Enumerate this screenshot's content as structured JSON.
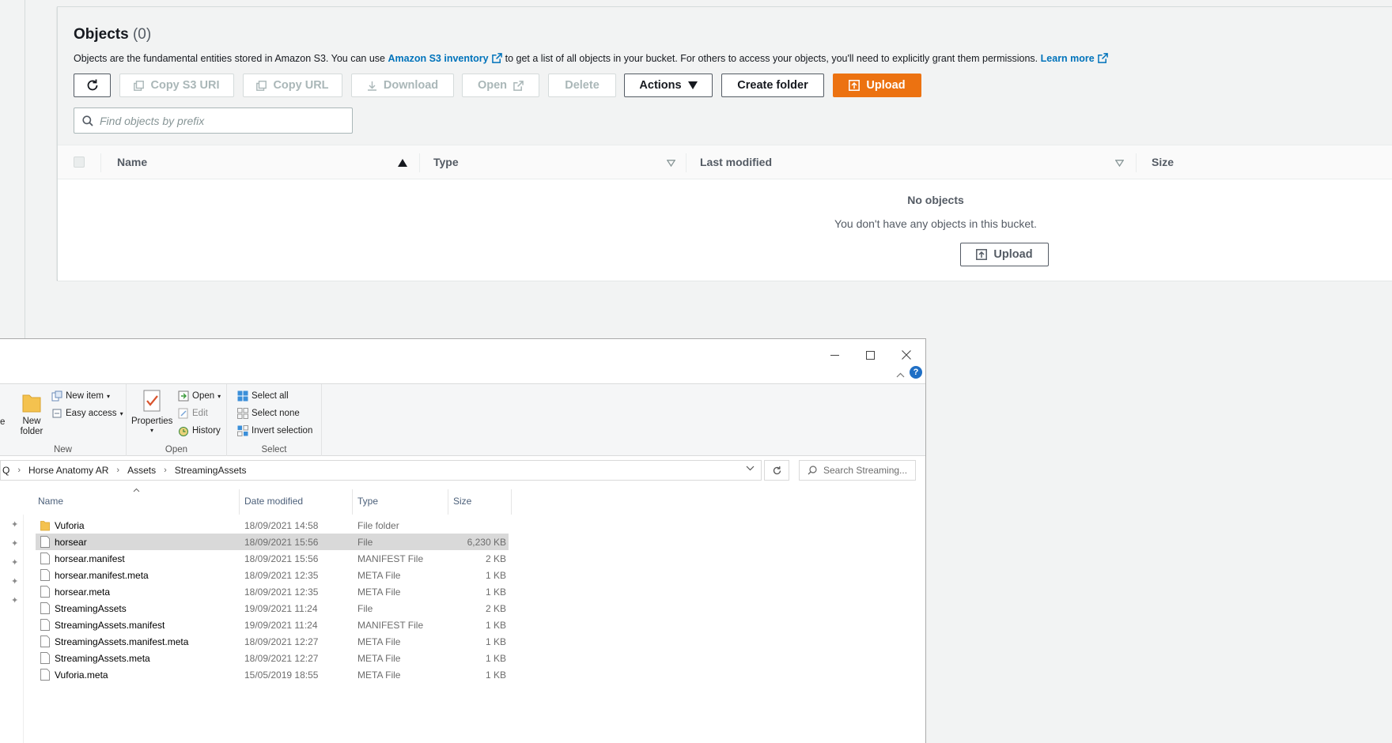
{
  "s3": {
    "objects_title": "Objects",
    "objects_count": "(0)",
    "description_pre": "Objects are the fundamental entities stored in Amazon S3. You can use",
    "inventory_link": "Amazon S3 inventory",
    "description_mid": "to get a list of all objects in your bucket. For others to access your objects, you'll need to explicitly grant them permissions.",
    "learn_more": "Learn more",
    "buttons": {
      "copy_s3_uri": "Copy S3 URI",
      "copy_url": "Copy URL",
      "download": "Download",
      "open": "Open",
      "delete": "Delete",
      "actions": "Actions",
      "create_folder": "Create folder",
      "upload": "Upload"
    },
    "search_placeholder": "Find objects by prefix",
    "columns": [
      "Name",
      "Type",
      "Last modified",
      "Size"
    ],
    "empty_title": "No objects",
    "empty_message": "You don't have any objects in this bucket.",
    "empty_upload": "Upload",
    "colors": {
      "accent": "#ec7211",
      "link": "#0073bb"
    }
  },
  "explorer": {
    "ribbon": {
      "new_item": "New item",
      "easy_access": "Easy access",
      "new_folder_line1": "New",
      "new_folder_line2": "folder",
      "group_new": "New",
      "properties": "Properties",
      "open": "Open",
      "edit": "Edit",
      "history": "History",
      "group_open": "Open",
      "select_all": "Select all",
      "select_none": "Select none",
      "invert_selection": "Invert selection",
      "group_select": "Select",
      "cut_fragment": "e"
    },
    "address": {
      "fragment": "Q",
      "crumbs": [
        "Horse Anatomy AR",
        "Assets",
        "StreamingAssets"
      ]
    },
    "search_placeholder": "Search Streaming...",
    "columns": {
      "name": "Name",
      "date": "Date modified",
      "type": "Type",
      "size": "Size"
    },
    "files": [
      {
        "name": "Vuforia",
        "date": "18/09/2021 14:58",
        "type": "File folder",
        "size": "",
        "folder": true
      },
      {
        "name": "horsear",
        "date": "18/09/2021 15:56",
        "type": "File",
        "size": "6,230 KB",
        "selected": true
      },
      {
        "name": "horsear.manifest",
        "date": "18/09/2021 15:56",
        "type": "MANIFEST File",
        "size": "2 KB"
      },
      {
        "name": "horsear.manifest.meta",
        "date": "18/09/2021 12:35",
        "type": "META File",
        "size": "1 KB"
      },
      {
        "name": "horsear.meta",
        "date": "18/09/2021 12:35",
        "type": "META File",
        "size": "1 KB"
      },
      {
        "name": "StreamingAssets",
        "date": "19/09/2021 11:24",
        "type": "File",
        "size": "2 KB"
      },
      {
        "name": "StreamingAssets.manifest",
        "date": "19/09/2021 11:24",
        "type": "MANIFEST File",
        "size": "1 KB"
      },
      {
        "name": "StreamingAssets.manifest.meta",
        "date": "18/09/2021 12:27",
        "type": "META File",
        "size": "1 KB"
      },
      {
        "name": "StreamingAssets.meta",
        "date": "18/09/2021 12:27",
        "type": "META File",
        "size": "1 KB"
      },
      {
        "name": "Vuforia.meta",
        "date": "15/05/2019 18:55",
        "type": "META File",
        "size": "1 KB"
      }
    ]
  }
}
